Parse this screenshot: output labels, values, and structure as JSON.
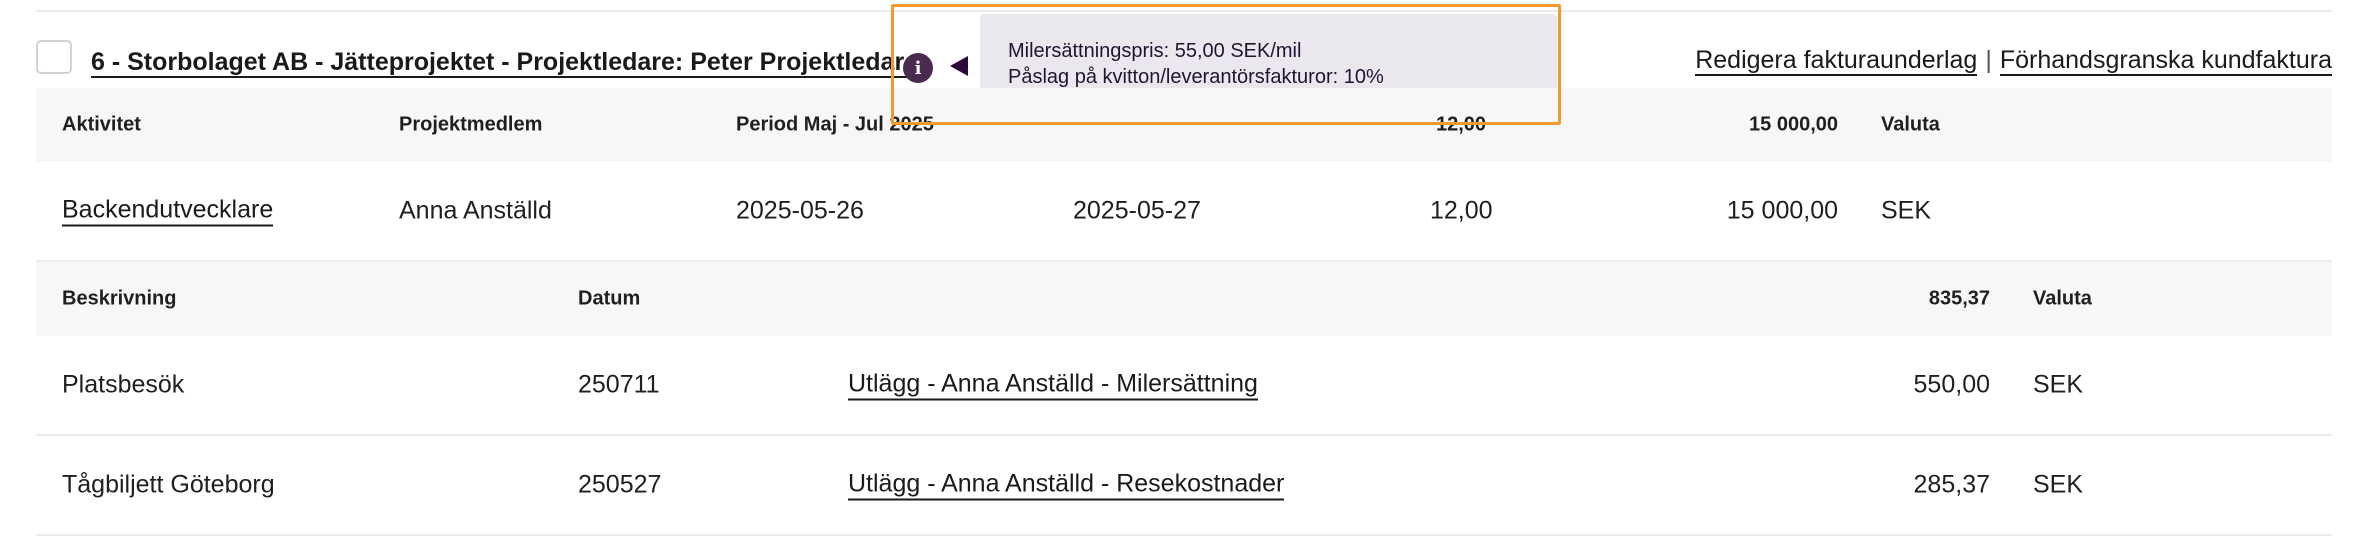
{
  "header": {
    "project_title": "6 - Storbolaget AB - Jätteprojektet - Projektledare: Peter Projektledare",
    "info_icon": "info-icon",
    "tooltip": {
      "line1": "Milersättningspris: 55,00 SEK/mil",
      "line2": "Påslag på kvitton/leverantörsfakturor: 10%"
    },
    "links": {
      "edit": "Redigera fakturaunderlag",
      "separator": "|",
      "preview": "Förhandsgranska kundfaktura"
    }
  },
  "activities": {
    "columns": {
      "activity": "Aktivitet",
      "member": "Projektmedlem",
      "period": "Period Maj - Jul 2025",
      "hours_total": "12,00",
      "amount_total": "15 000,00",
      "currency": "Valuta"
    },
    "rows": [
      {
        "activity": "Backendutvecklare",
        "member": "Anna Anställd",
        "start": "2025-05-26",
        "end": "2025-05-27",
        "hours": "12,00",
        "amount": "15 000,00",
        "currency": "SEK"
      }
    ]
  },
  "expenses": {
    "columns": {
      "description": "Beskrivning",
      "date": "Datum",
      "amount_total": "835,37",
      "currency": "Valuta"
    },
    "rows": [
      {
        "description": "Platsbesök",
        "date": "250711",
        "link": "Utlägg - Anna Anställd - Milersättning",
        "amount": "550,00",
        "currency": "SEK"
      },
      {
        "description": "Tågbiljett Göteborg",
        "date": "250527",
        "link": "Utlägg - Anna Anställd - Resekostnader",
        "amount": "285,37",
        "currency": "SEK"
      }
    ]
  }
}
